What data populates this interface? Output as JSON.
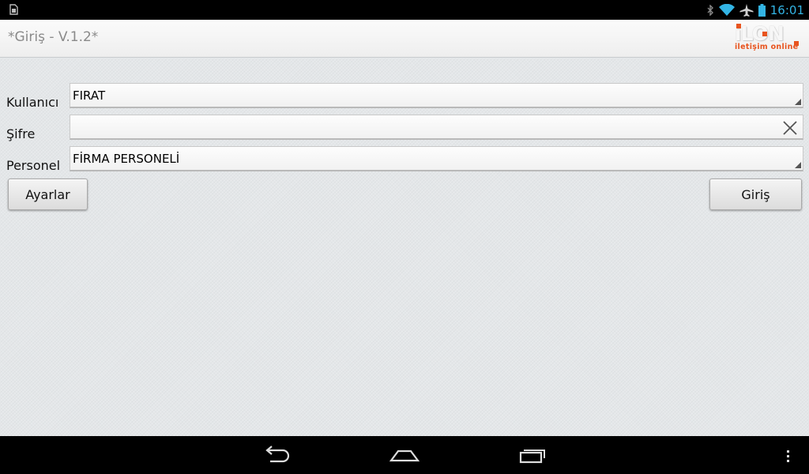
{
  "status_bar": {
    "time": "16:01",
    "icons": [
      "sim-card-icon",
      "bluetooth-icon",
      "wifi-icon",
      "airplane-icon",
      "battery-icon"
    ]
  },
  "title_bar": {
    "title": "*Giriş - V.1.2*",
    "logo": {
      "word": "iLON",
      "subtitle": "iletişim online"
    }
  },
  "form": {
    "user_label": "Kullanıcı",
    "user_value": "FIRAT",
    "password_label": "Şifre",
    "password_value": "",
    "staff_label": "Personel",
    "staff_value": "FİRMA PERSONELİ"
  },
  "buttons": {
    "settings": "Ayarlar",
    "login": "Giriş"
  },
  "nav_bar": {
    "icons": [
      "back-icon",
      "home-icon",
      "recent-apps-icon",
      "menu-icon"
    ]
  },
  "colors": {
    "accent": "#33b5e5",
    "brand": "#e8541e"
  }
}
